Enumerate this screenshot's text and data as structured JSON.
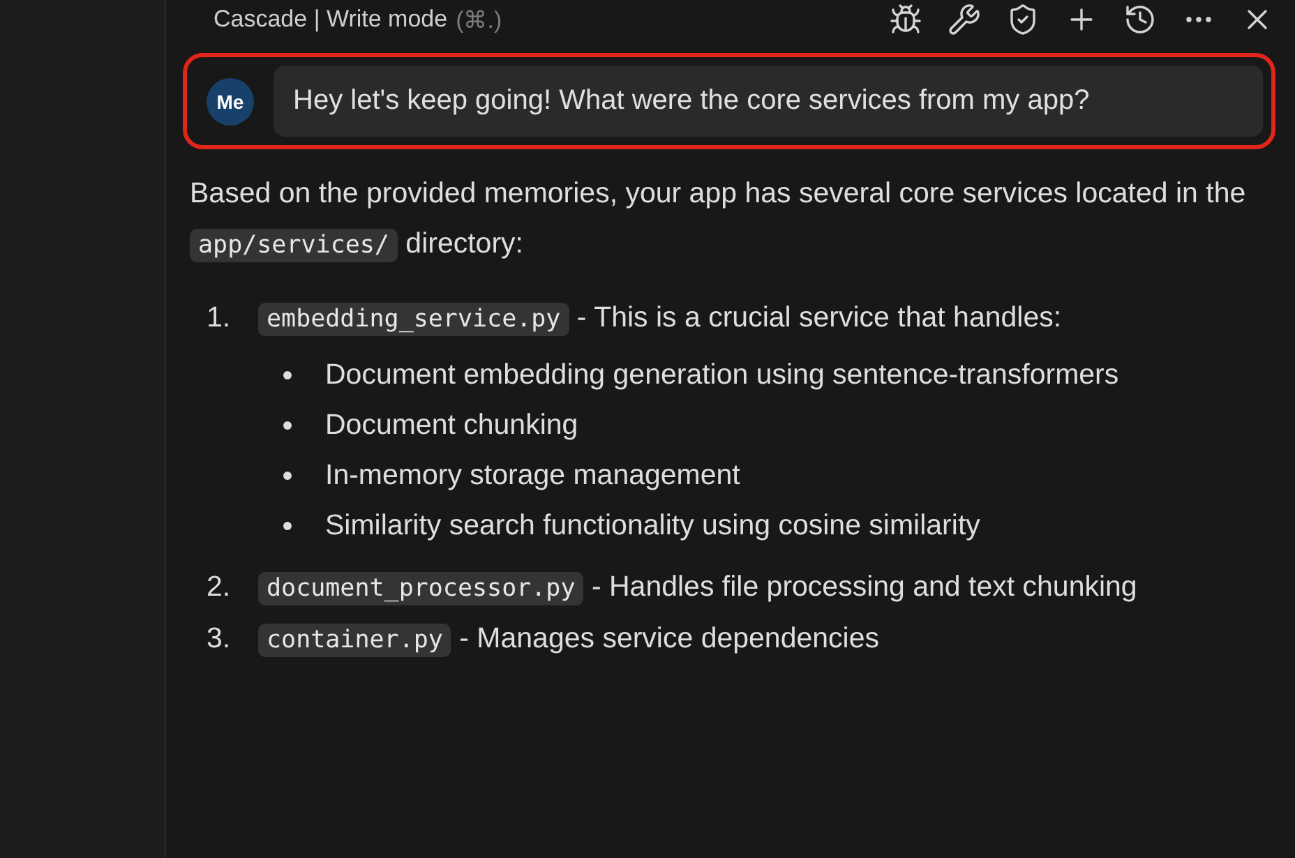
{
  "header": {
    "title": "Cascade | Write mode",
    "shortcut": "(⌘.)",
    "actions": [
      {
        "kind": "bug"
      },
      {
        "kind": "tools"
      },
      {
        "kind": "shield"
      },
      {
        "kind": "plus"
      },
      {
        "kind": "history"
      },
      {
        "kind": "more"
      },
      {
        "kind": "close"
      }
    ]
  },
  "user_message": {
    "avatar": "Me",
    "text": "Hey let's keep going! What were the core services from my app?",
    "highlighted": true
  },
  "response": {
    "intro": [
      {
        "kind": "text",
        "text": "Based on the provided memories, your app has several core services located in the"
      },
      {
        "kind": "code",
        "text": "app/services/"
      },
      {
        "kind": "text",
        "text": "directory:"
      }
    ],
    "items": [
      {
        "number": "1.",
        "code": "embedding_service.py",
        "text": "- This is a crucial service that handles:",
        "bullets": [
          "Document embedding generation using sentence-transformers",
          "Document chunking",
          "In-memory storage management",
          "Similarity search functionality using cosine similarity"
        ]
      },
      {
        "number": "2.",
        "code": "document_processor.py",
        "text": "- Handles file processing and text chunking"
      },
      {
        "number": "3.",
        "code": "container.py",
        "text": "- Manages service dependencies"
      }
    ]
  }
}
